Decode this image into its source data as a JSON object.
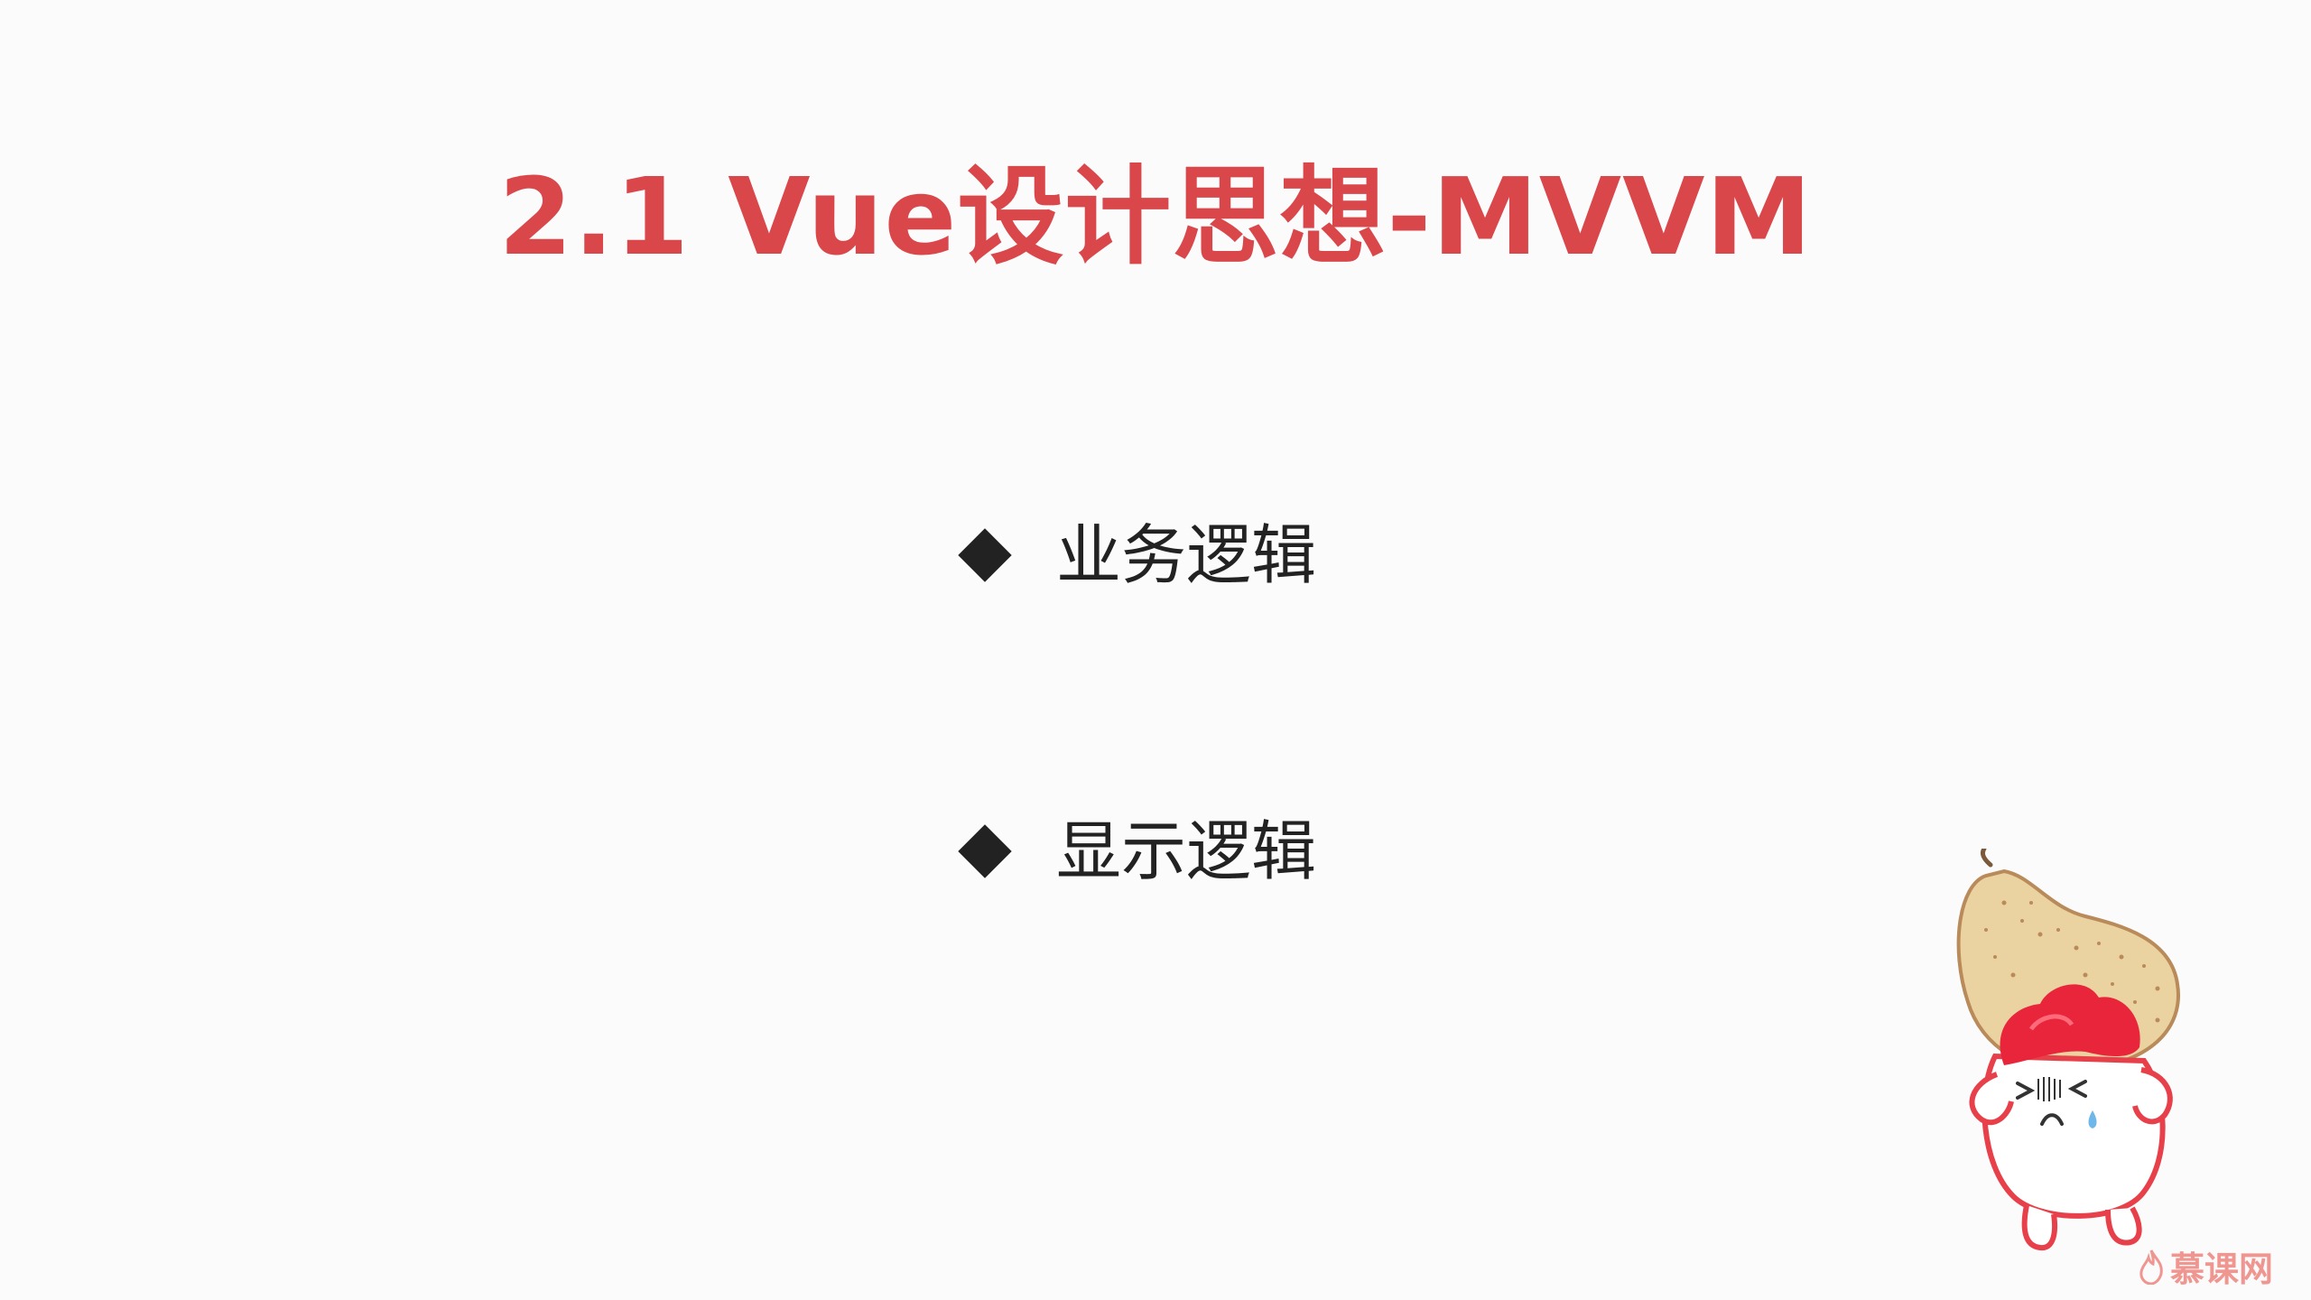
{
  "slide": {
    "title": "2.1 Vue设计思想-MVVM",
    "bullets": [
      {
        "label": "业务逻辑"
      },
      {
        "label": "显示逻辑"
      }
    ]
  },
  "watermark": {
    "label": "慕课网",
    "icon": "flame-icon"
  },
  "mascot": {
    "icon": "mascot-carrying-pear-icon"
  },
  "colors": {
    "title": "#d9474b",
    "text": "#222222",
    "background": "#fbfbfb",
    "brand": "#e8453c"
  }
}
